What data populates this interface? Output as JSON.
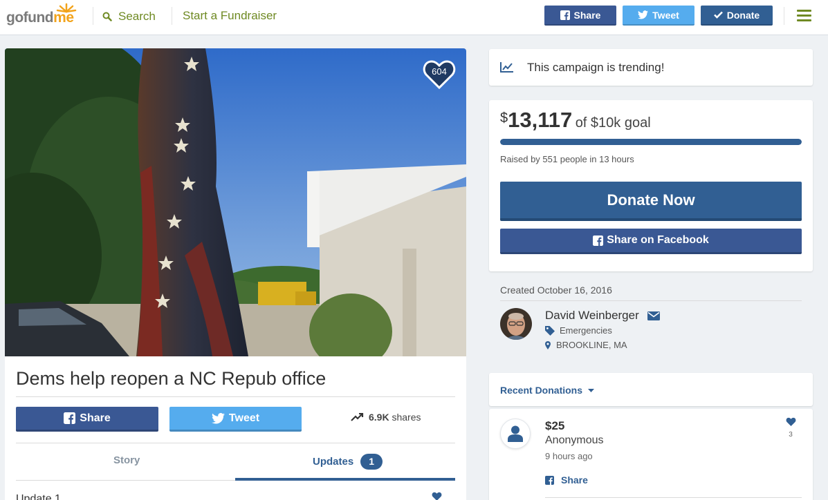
{
  "header": {
    "logo_left": "gofund",
    "logo_right": "me",
    "search_label": "Search",
    "start_label": "Start a Fundraiser",
    "share_label": "Share",
    "tweet_label": "Tweet",
    "donate_label": "Donate"
  },
  "campaign": {
    "hearts": "604",
    "title": "Dems help reopen a NC Repub office",
    "share_label": "Share",
    "tweet_label": "Tweet",
    "shares_count": "6.9K",
    "shares_suffix": "shares"
  },
  "tabs": {
    "story_label": "Story",
    "updates_label": "Updates",
    "updates_count": "1"
  },
  "update": {
    "title": "Update 1"
  },
  "trending": {
    "text": "This campaign is trending!"
  },
  "funding": {
    "currency": "$",
    "raised": "13,117",
    "goal_text": "of $10k goal",
    "progress_fraction": 1.0,
    "raised_by": "Raised by 551 people in 13 hours",
    "donate_now_label": "Donate Now",
    "share_facebook_label": "Share on Facebook"
  },
  "organizer": {
    "created": "Created October 16, 2016",
    "name": "David Weinberger",
    "category": "Emergencies",
    "location": "BROOKLINE, MA"
  },
  "recent_donations": {
    "label": "Recent Donations",
    "items": [
      {
        "amount": "$25",
        "name": "Anonymous",
        "time": "9 hours ago",
        "hearts": "3",
        "share_label": "Share"
      }
    ]
  },
  "colors": {
    "brand_blue": "#315f93",
    "facebook": "#3a5894",
    "twitter": "#55acee",
    "gofundme_green": "#6f8a23",
    "gofundme_orange": "#f2a31b"
  }
}
